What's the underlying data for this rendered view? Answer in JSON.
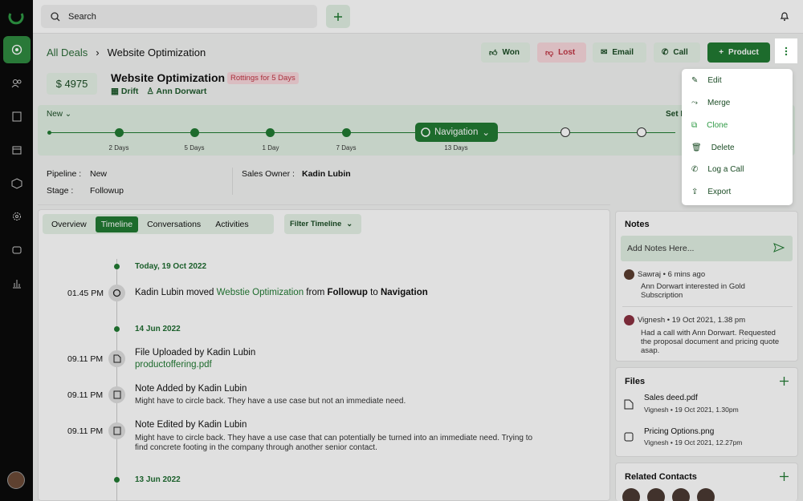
{
  "topbar": {
    "search_placeholder": "Search"
  },
  "breadcrumb": {
    "root": "All Deals",
    "current": "Website Optimization"
  },
  "actions": {
    "won": "Won",
    "lost": "Lost",
    "email": "Email",
    "call": "Call",
    "product": "Product"
  },
  "deal": {
    "amount": "$ 4975",
    "title": "Website Optimization",
    "badge": "Rottings for 5 Days",
    "company": "Drift",
    "contact": "Ann Dorwart"
  },
  "pipeline": {
    "stage_selector": "New",
    "set_label": "Set I",
    "current": "Navigation",
    "labels": [
      "2 Days",
      "5 Days",
      "1 Day",
      "7 Days",
      "13 Days"
    ]
  },
  "info": {
    "pipeline_label": "Pipeline :",
    "pipeline_value": "New",
    "stage_label": "Stage :",
    "stage_value": "Followup",
    "owner_label": "Sales Owner :",
    "owner_value": "Kadin Lubin"
  },
  "tabs": [
    "Overview",
    "Timeline",
    "Conversations",
    "Activities"
  ],
  "filter": "Filter Timeline",
  "timeline": {
    "d1": "Today, 19 Oct 2022",
    "e1": {
      "time": "01.45 PM",
      "a": "Kadin Lubin moved ",
      "link": "Webstie Optimization",
      "b": " from ",
      "c": "Followup",
      "d": " to ",
      "e": "Navigation"
    },
    "d2": "14 Jun 2022",
    "e2": {
      "time": "09.11 PM",
      "title": "File Uploaded by Kadin Lubin",
      "file": "productoffering.pdf"
    },
    "e3": {
      "time": "09.11 PM",
      "title": "Note Added by Kadin Lubin",
      "text": "Might have to circle back. They have a use case but not an immediate need."
    },
    "e4": {
      "time": "09.11 PM",
      "title": "Note Edited by Kadin Lubin",
      "text1": "Might have to circle back. They have a use case that can potentially be turned into an immediate need. Trying to",
      "text2": "find concrete footing in the company through another senior contact."
    },
    "d3": "13 Jun 2022"
  },
  "notes": {
    "title": "Notes",
    "placeholder": "Add Notes Here...",
    "n1": {
      "meta": "Sawraj  •  6 mins ago",
      "l1": "Ann Dorwart interested in Gold",
      "l2": "Subscription"
    },
    "n2": {
      "meta": "Vignesh  •  19 Oct 2021, 1.38 pm",
      "l1": "Had a call with Ann Dorwart. Requested",
      "l2": "the proposal document and pricing quote",
      "l3": "asap."
    }
  },
  "files": {
    "title": "Files",
    "f1": {
      "name": "Sales deed.pdf",
      "meta": "Vignesh  •  19 Oct 2021, 1.30pm"
    },
    "f2": {
      "name": "Pricing Options.png",
      "meta": "Vignesh  •  19 Oct 2021, 12.27pm"
    }
  },
  "related": {
    "title": "Related Contacts"
  },
  "menu": {
    "edit": "Edit",
    "merge": "Merge",
    "clone": "Clone",
    "delete": "Delete",
    "log_call": "Log a Call",
    "export": "Export"
  },
  "colors": {
    "accent": "#217a33",
    "light": "#e5f2e6",
    "danger": "#c13645"
  }
}
